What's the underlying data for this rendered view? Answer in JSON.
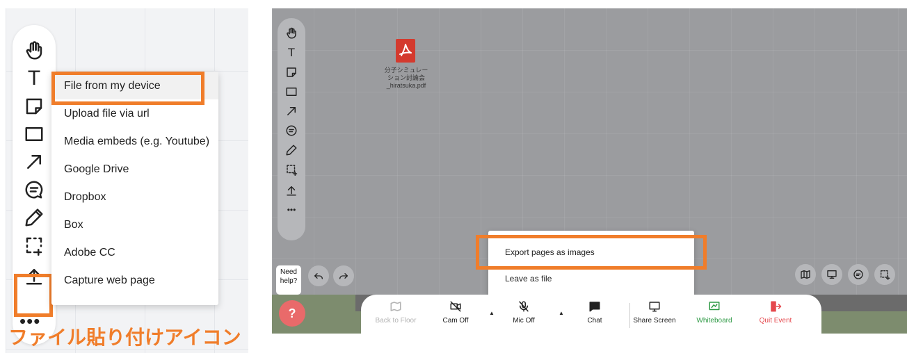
{
  "left_panel": {
    "upload_menu": {
      "items": [
        "File from my device",
        "Upload file via url",
        "Media embeds (e.g. Youtube)",
        "Google Drive",
        "Dropbox",
        "Box",
        "Adobe CC",
        "Capture web page"
      ]
    },
    "caption": "ファイル貼り付けアイコン",
    "text_tool_label": "T",
    "more_label": "•••",
    "toolbar_icons": [
      "hand-icon",
      "text-icon",
      "sticky-note-icon",
      "rectangle-icon",
      "arrow-icon",
      "comment-icon",
      "pen-icon",
      "selection-icon",
      "upload-icon",
      "more-icon"
    ]
  },
  "right_panel": {
    "file": {
      "name_line1": "分子シミュレー",
      "name_line2": "ション討論会",
      "name_line3": "_hiratsuka.pdf"
    },
    "help": {
      "line1": "Need",
      "line2": "help?",
      "button": "?"
    },
    "text_tool_label": "T",
    "more_label": "•••",
    "export_menu": {
      "items": [
        "Export pages as images",
        "Leave as file"
      ]
    },
    "bottom_bar": {
      "items": [
        {
          "label": "Back to Floor",
          "color": "#b3b3b3"
        },
        {
          "label": "Cam Off",
          "color": "#222222"
        },
        {
          "label": "Mic Off",
          "color": "#222222"
        },
        {
          "label": "Chat",
          "color": "#222222"
        },
        {
          "label": "Share Screen",
          "color": "#222222"
        },
        {
          "label": "Whiteboard",
          "color": "#2f9a46"
        },
        {
          "label": "Quit Event",
          "color": "#e5484d"
        }
      ]
    }
  },
  "colors": {
    "highlight": "#f07d2a",
    "pdf": "#d43a2e",
    "whiteboard": "#2f9a46",
    "quit": "#e5484d"
  }
}
